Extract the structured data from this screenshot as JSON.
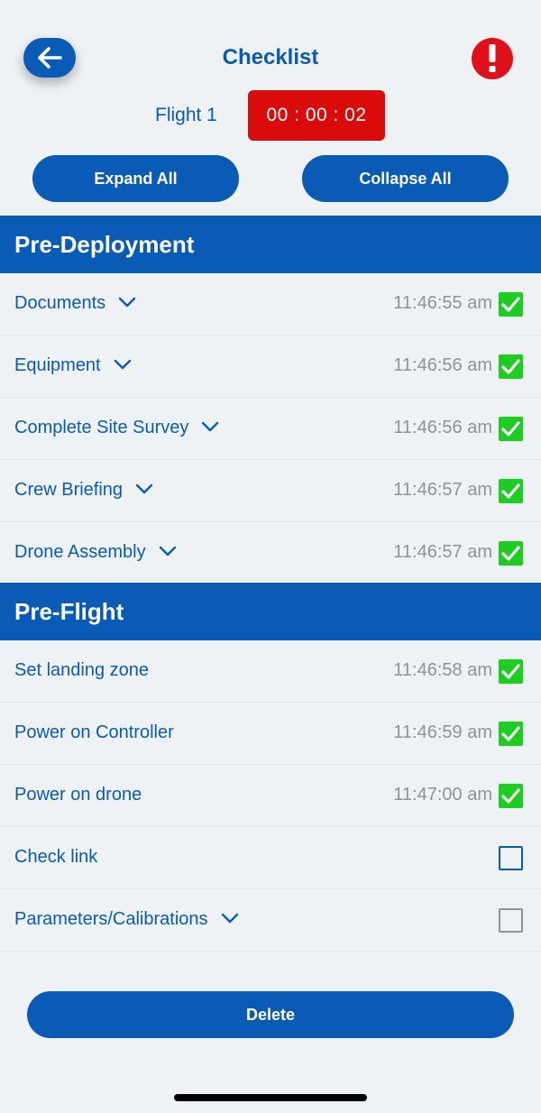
{
  "header": {
    "title": "Checklist",
    "back_icon": "arrow-left-icon",
    "alert_icon": "exclamation-icon",
    "flight_label": "Flight 1",
    "timer": "00 : 00 : 02",
    "expand_all": "Expand All",
    "collapse_all": "Collapse All"
  },
  "sections": [
    {
      "title": "Pre-Deployment",
      "items": [
        {
          "label": "Documents",
          "time": "11:46:55 am",
          "checked": true,
          "expandable": true
        },
        {
          "label": "Equipment",
          "time": "11:46:56 am",
          "checked": true,
          "expandable": true
        },
        {
          "label": "Complete Site Survey",
          "time": "11:46:56 am",
          "checked": true,
          "expandable": true
        },
        {
          "label": "Crew Briefing",
          "time": "11:46:57 am",
          "checked": true,
          "expandable": true
        },
        {
          "label": "Drone Assembly",
          "time": "11:46:57 am",
          "checked": true,
          "expandable": true
        }
      ]
    },
    {
      "title": "Pre-Flight",
      "items": [
        {
          "label": "Set landing zone",
          "time": "11:46:58 am",
          "checked": true,
          "expandable": false
        },
        {
          "label": "Power on Controller",
          "time": "11:46:59 am",
          "checked": true,
          "expandable": false
        },
        {
          "label": "Power on drone",
          "time": "11:47:00 am",
          "checked": true,
          "expandable": false
        },
        {
          "label": "Check link",
          "time": "",
          "checked": false,
          "expandable": false
        },
        {
          "label": "Parameters/Calibrations",
          "time": "",
          "checked": false,
          "expandable": true
        }
      ]
    }
  ],
  "footer": {
    "delete_label": "Delete"
  },
  "colors": {
    "primary": "#0A5BB5",
    "timer_red": "#D90B0B",
    "alert_red": "#E0101A",
    "check_green": "#1DCD22",
    "time_gray": "#8E9399",
    "background": "#EEF2F5"
  }
}
